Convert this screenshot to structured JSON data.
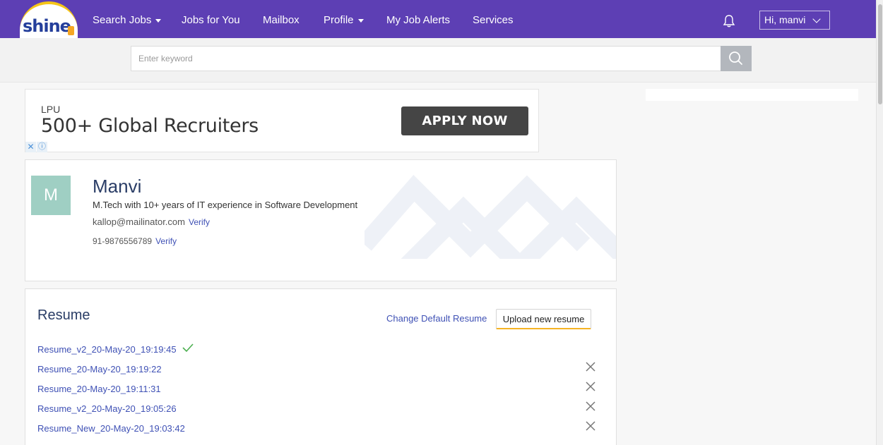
{
  "header": {
    "logo_text": "shine",
    "nav": [
      {
        "label": "Search Jobs",
        "dropdown": true
      },
      {
        "label": "Jobs for You",
        "dropdown": false
      },
      {
        "label": "Mailbox",
        "dropdown": false
      },
      {
        "label": "Profile",
        "dropdown": true
      },
      {
        "label": "My Job Alerts",
        "dropdown": false
      },
      {
        "label": "Services",
        "dropdown": false
      }
    ],
    "user_greeting": "Hi,  manvi",
    "brand_color": "#5d3fb4"
  },
  "search": {
    "placeholder": "Enter keyword"
  },
  "ad": {
    "brand": "LPU",
    "headline": "500+ Global Recruiters",
    "cta": "APPLY NOW"
  },
  "profile": {
    "initial": "M",
    "name": "Manvi",
    "headline": "M.Tech with 10+ years of IT experience in Software Development",
    "email": "kallop@mailinator.com",
    "email_verify": "Verify",
    "phone": "91-9876556789",
    "phone_verify": "Verify"
  },
  "resume": {
    "title": "Resume",
    "change_default_label": "Change Default Resume",
    "upload_label": "Upload new resume",
    "files": [
      {
        "name": "Resume_v2_20-May-20_19:19:45",
        "default": true
      },
      {
        "name": "Resume_20-May-20_19:19:22",
        "default": false
      },
      {
        "name": "Resume_20-May-20_19:11:31",
        "default": false
      },
      {
        "name": "Resume_v2_20-May-20_19:05:26",
        "default": false
      },
      {
        "name": "Resume_New_20-May-20_19:03:42",
        "default": false
      }
    ]
  }
}
